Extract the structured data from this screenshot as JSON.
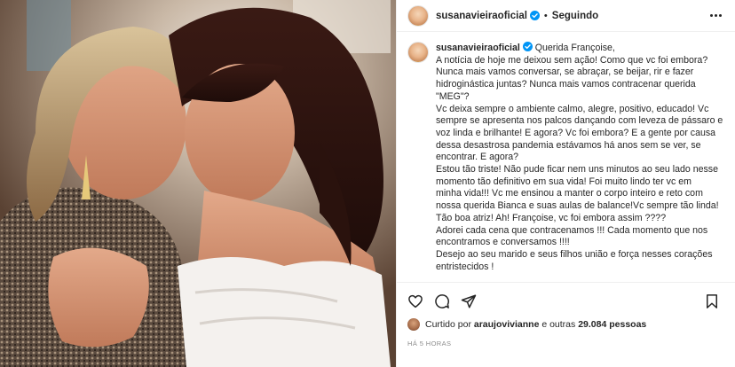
{
  "post": {
    "image_description_alt": "photo"
  },
  "header": {
    "handle": "susanavieiraoficial",
    "separator": "•",
    "follow_label": "Seguindo"
  },
  "caption": {
    "handle": "susanavieiraoficial",
    "lines": [
      "Querida Françoise,",
      "A notícia de hoje me deixou sem ação! Como que vc foi embora?",
      "Nunca mais vamos conversar, se abraçar, se beijar, rir e fazer",
      "hidroginástica juntas? Nunca mais vamos contracenar querida",
      "\"MEG\"?",
      "Vc deixa sempre o ambiente calmo, alegre, positivo, educado! Vc",
      "sempre se apresenta nos palcos dançando com leveza de pássaro e",
      "voz linda e brilhante! E agora? Vc foi embora? E a gente por causa",
      "dessa desastrosa pandemia estávamos há anos sem se ver, se",
      "encontrar. E agora?",
      "Estou tão triste! Não pude ficar nem uns minutos ao seu lado nesse",
      "momento tão definitivo em sua vida! Foi muito lindo ter vc em",
      "minha vida!!! Vc me ensinou a manter o corpo inteiro e reto com",
      "nossa querida Bianca e suas aulas de balance!Vc sempre tão linda!",
      "Tão boa atriz! Ah! Françoise, vc foi embora assim ????",
      "Adorei cada cena que contracenamos !!! Cada momento que nos",
      "encontramos e conversamos !!!!",
      "Desejo ao seu marido e seus filhos união e força nesses corações",
      "entristecidos !"
    ]
  },
  "likes": {
    "prefix": "Curtido por ",
    "user": "araujovivianne",
    "middle": " e outras ",
    "count": "29.084 pessoas"
  },
  "timestamp": "HÁ 5 HORAS",
  "icons": {
    "verified": "verified-badge-icon",
    "more": "more-options-icon",
    "like": "heart-icon",
    "comment": "comment-icon",
    "share": "share-icon",
    "save": "bookmark-icon"
  },
  "colors": {
    "verified_blue": "#0095f6",
    "text": "#262626",
    "muted": "#8e8e8e",
    "border": "#efefef"
  }
}
